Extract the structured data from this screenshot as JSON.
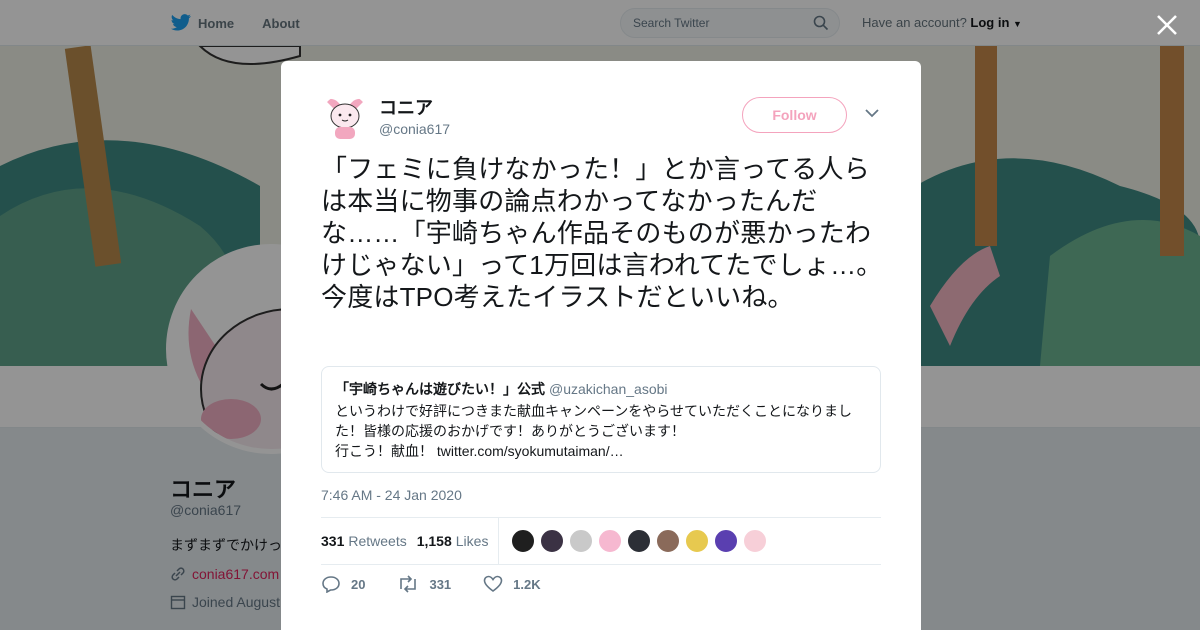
{
  "topbar": {
    "home_label": "Home",
    "about_label": "About",
    "search_placeholder": "Search Twitter",
    "account_prompt": "Have an account?",
    "login_label": "Log in"
  },
  "profile": {
    "name": "コニア",
    "handle": "@conia617",
    "bio": "まずまずでかけっ",
    "link": "conia617.com",
    "joined": "Joined August"
  },
  "tweet": {
    "author_name": "コニア",
    "author_handle": "@conia617",
    "follow_label": "Follow",
    "text": "「フェミに負けなかった！」とか言ってる人らは本当に物事の論点わかってなかったんだな……「宇崎ちゃん作品そのものが悪かったわけじゃない」って1万回は言われてたでしょ…。今度はTPO考えたイラストだといいね。",
    "quote": {
      "name": "「宇崎ちゃんは遊びたい！」公式",
      "handle": "@uzakichan_asobi",
      "text": "というわけで好評につきまた献血キャンペーンをやらせていただくことになりました！皆様の応援のおかげです！ありがとうございます！\n行こう！献血！ twitter.com/syokumutaiman/…"
    },
    "timestamp": "7:46 AM - 24 Jan 2020",
    "retweets_count": "331",
    "retweets_label": "Retweets",
    "likes_count": "1,158",
    "likes_label": "Likes",
    "likers": [
      "#1f1f1f",
      "#3b3244",
      "#c9c9c9",
      "#f6b8d0",
      "#2c2f36",
      "#8a6a5a",
      "#e7c94f",
      "#5a3fb0",
      "#f7cfd8"
    ],
    "reply_count": "20",
    "retweet_action_count": "331",
    "like_action_count": "1.2K"
  },
  "colors": {
    "brand_blue": "#1da1f2",
    "follow_pink": "#f4a3bd",
    "link_pink": "#e0245e"
  }
}
